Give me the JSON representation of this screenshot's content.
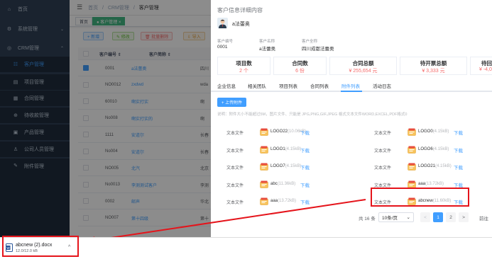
{
  "sidebar": {
    "items": [
      {
        "label": "首页",
        "icon": "home-icon"
      },
      {
        "label": "系统管理",
        "icon": "gear-icon"
      },
      {
        "label": "CRM管理",
        "icon": "crm-icon"
      },
      {
        "label": "客户管理",
        "icon": "user-icon"
      },
      {
        "label": "项目管理",
        "icon": "project-icon"
      },
      {
        "label": "合同管理",
        "icon": "contract-icon"
      },
      {
        "label": "待收款管理",
        "icon": "money-icon"
      },
      {
        "label": "产品管理",
        "icon": "product-icon"
      },
      {
        "label": "公司人员管理",
        "icon": "people-icon"
      },
      {
        "label": "附件管理",
        "icon": "attach-icon"
      }
    ]
  },
  "breadcrumb": {
    "home": "首页",
    "sep": "/",
    "crm": "CRM管理",
    "current": "客户管理"
  },
  "tags": {
    "home": "首页",
    "active": "● 客户管理 ×"
  },
  "toolbar": {
    "add": "+ 新增",
    "edit": "✎ 修改",
    "delete": "🗑 批量删除",
    "import": "⇩ 导入"
  },
  "table": {
    "headers": [
      "客户编号 ⇕",
      "客户简称 ⇕"
    ],
    "rows": [
      {
        "id": "0001",
        "name": "a法蕾奥",
        "extra": "四川"
      },
      {
        "id": "NO0012",
        "name": "zxdwd",
        "extra": "wda"
      },
      {
        "id": "60010",
        "name": "啊实打实",
        "extra": "啊"
      },
      {
        "id": "No008",
        "name": "啊实打实的",
        "extra": "啊"
      },
      {
        "id": "1111",
        "name": "安道尔",
        "extra": "长春"
      },
      {
        "id": "No004",
        "name": "安道尔",
        "extra": "长春"
      },
      {
        "id": "NO005",
        "name": "北汽",
        "extra": "北京"
      },
      {
        "id": "No0013",
        "name": "李测测试客户",
        "extra": "李测"
      },
      {
        "id": "0002",
        "name": "邮声",
        "extra": "华北"
      },
      {
        "id": "NO007",
        "name": "第十四级",
        "extra": "第十"
      }
    ]
  },
  "drawer": {
    "title": "客户信息详细内容",
    "customer_name": "a法蕾奥",
    "info": {
      "code_label": "客户编号",
      "code_value": "0001",
      "name_label": "客户名称",
      "name_value": "a法蕾奥",
      "full_label": "客户全称",
      "full_value": "四川成都法蕾奥"
    },
    "stats": [
      {
        "title": "项目数",
        "value": "2 个"
      },
      {
        "title": "合同数",
        "value": "6 份"
      },
      {
        "title": "合同总额",
        "value": "¥ 255,654 元"
      },
      {
        "title": "待开票总额",
        "value": "¥ 3,333 元"
      },
      {
        "title": "待回",
        "value": "¥ -4,0"
      }
    ],
    "tabs": [
      "企业信息",
      "相关团队",
      "项目列表",
      "合同列表",
      "附件列表",
      "活动日志"
    ],
    "active_tab": "附件列表",
    "upload_label": "+ 上传附件",
    "hint": "说明：附件大小不能超过5M，图片文件、只能是 JPG,PNG,GIF,JPEG 格式文本文件WORD,EXCEL,PDF格式0",
    "file_type": "文本文件",
    "download": "下载",
    "files": [
      {
        "name": "LOGO22",
        "size": "(10.06kB)"
      },
      {
        "name": "LOGO0",
        "size": "(4.15kB)"
      },
      {
        "name": "LOGO1",
        "size": "(4.15kB)"
      },
      {
        "name": "LOGO6",
        "size": "(4.15kB)"
      },
      {
        "name": "LOGO7",
        "size": "(4.15kB)"
      },
      {
        "name": "LOGO21",
        "size": "(4.15kB)"
      },
      {
        "name": "abc",
        "size": "(11.36kB)"
      },
      {
        "name": "aaa",
        "size": "(13.72kB)"
      },
      {
        "name": "aaa",
        "size": "(13.72kB)"
      },
      {
        "name": "abcnew",
        "size": "(11.60kB)"
      }
    ],
    "pager": {
      "total": "共 16 条",
      "page_size": "10条/页",
      "prev": "<",
      "page1": "1",
      "page2": "2",
      "next": ">",
      "goto": "前往"
    }
  },
  "download_bar": {
    "name": "abcnew (2).docx",
    "size": "12.0/12.0 kB",
    "chevron": "^"
  },
  "colors": {
    "sidebar": "#304156",
    "accent": "#409eff",
    "highlight": "#e5141b",
    "danger": "#f56c6c"
  }
}
